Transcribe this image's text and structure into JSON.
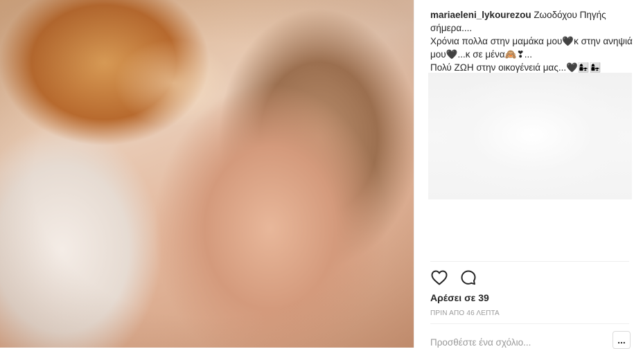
{
  "post": {
    "username": "mariaeleni_lykourezou",
    "caption_line1": " Ζωοδόχου Πηγής σήμερα....",
    "caption_line2": "Χρόνια πολλα στην μαμάκα μου🖤κ στην ανηψιά μου🖤...κ σε μένα🙈❣...",
    "caption_line3": "Πολύ ΖΩΗ στην οικογένειά μας...🖤👩‍👧👩‍👧",
    "likes_text": "Αρέσει σε 39",
    "time_text": "ΠΡΙΝ ΑΠΟ 46 ΛΕΠΤΑ"
  },
  "actions": {
    "like_icon": "heart-outline-icon",
    "comment_icon": "comment-bubble-icon"
  },
  "comment": {
    "placeholder": "Προσθέστε ένα σχόλιο...",
    "more_label": "..."
  },
  "colors": {
    "text": "#262626",
    "muted": "#999999",
    "divider": "#efefef"
  }
}
